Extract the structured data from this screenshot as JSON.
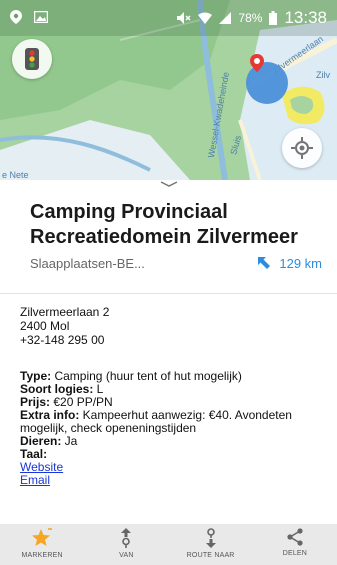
{
  "status_bar": {
    "battery_percent": "78%",
    "time": "13:38"
  },
  "map": {
    "labels": {
      "road_1": "Zilvermeerlaan",
      "road_2": "Wessel-Kwadeheinde",
      "road_3": "Sluis",
      "road_4": "Zilv",
      "place_1": "e Nete"
    },
    "colors": {
      "land": "#a6d3a0",
      "forest": "#8fc58a",
      "water": "#9ec9e6",
      "road": "#f7f2d8",
      "yellow_area": "#f3ea63",
      "pin_blue": "#4a90d9"
    }
  },
  "place": {
    "title": "Camping Provinciaal Recreatiedomein Zilvermeer",
    "category": "Slaapplaatsen-BE...",
    "distance": "129 km",
    "address_lines": [
      "Zilvermeerlaan 2",
      "2400 Mol",
      "+32-148 295 00"
    ],
    "details": {
      "type_label": "Type:",
      "type_value": " Camping (huur tent of hut mogelijk)",
      "soort_label": "Soort logies:",
      "soort_value": " L",
      "prijs_label": "Prijs:",
      "prijs_value": " €20 PP/PN",
      "extra_label": "Extra info:",
      "extra_value": " Kampeerhut aanwezig: €40. Avondeten mogelijk, check openeningstijden",
      "dieren_label": "Dieren:",
      "dieren_value": " Ja",
      "taal_label": "Taal:",
      "website_link": "Website",
      "email_link": "Email"
    }
  },
  "actions": [
    {
      "label": "MARKEREN",
      "icon": "star-icon"
    },
    {
      "label": "VAN",
      "icon": "route-from-icon"
    },
    {
      "label": "ROUTE NAAR",
      "icon": "route-to-icon"
    },
    {
      "label": "DELEN",
      "icon": "share-icon"
    }
  ]
}
